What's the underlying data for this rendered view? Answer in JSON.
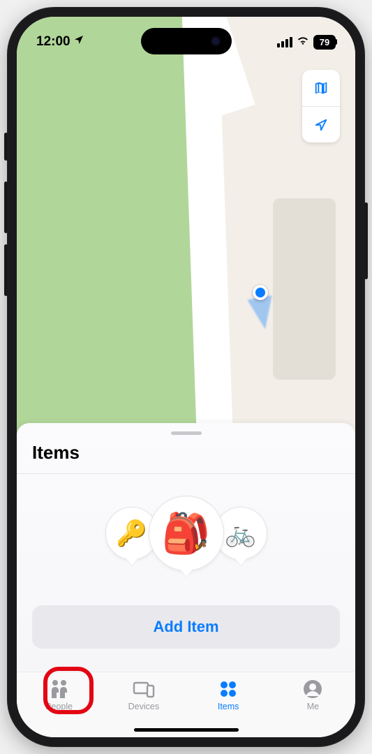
{
  "status": {
    "time": "12:00",
    "battery": "79"
  },
  "sheet": {
    "title": "Items",
    "add_button": "Add Item"
  },
  "items_graphic": {
    "left": "🔑",
    "center": "🎒",
    "right": "🚲"
  },
  "map_controls": {
    "maps_icon": "maps",
    "locate_icon": "locate"
  },
  "tabs": {
    "people": "People",
    "devices": "Devices",
    "items": "Items",
    "me": "Me"
  }
}
